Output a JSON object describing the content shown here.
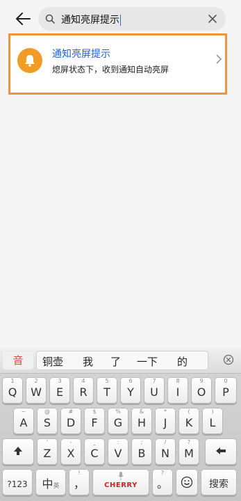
{
  "search": {
    "query": "通知亮屏提示"
  },
  "result": {
    "title": "通知亮屏提示",
    "subtitle": "熄屏状态下，收到通知自动亮屏"
  },
  "keyboard": {
    "mode_label": "音",
    "candidates": [
      "铜壶",
      "我",
      "了",
      "一下",
      "的"
    ],
    "row1": [
      {
        "main": "Q",
        "sub": "1"
      },
      {
        "main": "W",
        "sub": "2"
      },
      {
        "main": "E",
        "sub": "3"
      },
      {
        "main": "R",
        "sub": "4"
      },
      {
        "main": "T",
        "sub": "5"
      },
      {
        "main": "Y",
        "sub": "6"
      },
      {
        "main": "U",
        "sub": "7"
      },
      {
        "main": "I",
        "sub": "8"
      },
      {
        "main": "O",
        "sub": "9"
      },
      {
        "main": "P",
        "sub": "0"
      }
    ],
    "row2": [
      {
        "main": "A",
        "sub": "~"
      },
      {
        "main": "S",
        "sub": "@"
      },
      {
        "main": "D",
        "sub": "#"
      },
      {
        "main": "F",
        "sub": "$"
      },
      {
        "main": "G",
        "sub": "%"
      },
      {
        "main": "H",
        "sub": "&"
      },
      {
        "main": "J",
        "sub": "*"
      },
      {
        "main": "K",
        "sub": "("
      },
      {
        "main": "L",
        "sub": ")"
      }
    ],
    "row3": [
      {
        "main": "Z",
        "sub": "'"
      },
      {
        "main": "X",
        "sub": "-"
      },
      {
        "main": "C",
        "sub": "_"
      },
      {
        "main": "V",
        "sub": ":"
      },
      {
        "main": "B",
        "sub": ";"
      },
      {
        "main": "N",
        "sub": "/"
      },
      {
        "main": "M",
        "sub": "?"
      }
    ],
    "num_label": "?123",
    "lang_label": "中",
    "lang_sub": "英",
    "comma": "，",
    "comma_sub": "!",
    "space_brand": "CHERRY",
    "period": "。",
    "period_sub": "?",
    "search_label": "搜索"
  },
  "colors": {
    "accent": "#1f5fd6",
    "highlight_border": "#f0953a",
    "bell_bg": "#f39b27"
  }
}
